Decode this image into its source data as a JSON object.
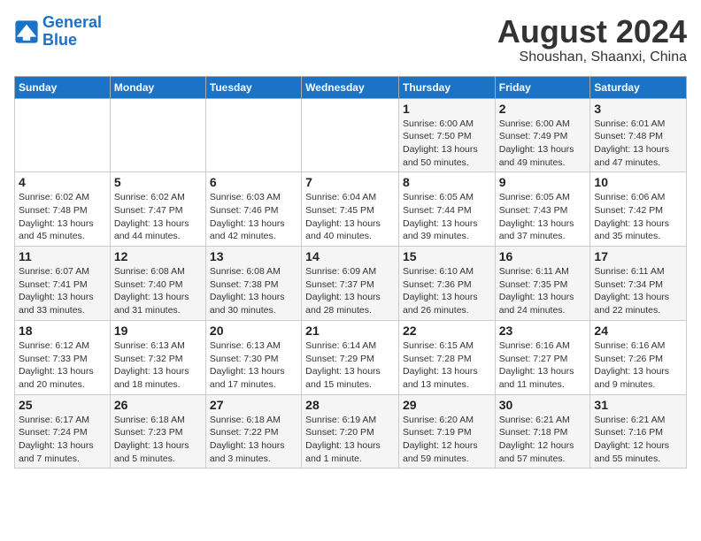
{
  "logo": {
    "text_general": "General",
    "text_blue": "Blue"
  },
  "title": "August 2024",
  "subtitle": "Shoushan, Shaanxi, China",
  "days_of_week": [
    "Sunday",
    "Monday",
    "Tuesday",
    "Wednesday",
    "Thursday",
    "Friday",
    "Saturday"
  ],
  "weeks": [
    [
      {
        "day": "",
        "detail": ""
      },
      {
        "day": "",
        "detail": ""
      },
      {
        "day": "",
        "detail": ""
      },
      {
        "day": "",
        "detail": ""
      },
      {
        "day": "1",
        "detail": "Sunrise: 6:00 AM\nSunset: 7:50 PM\nDaylight: 13 hours and 50 minutes."
      },
      {
        "day": "2",
        "detail": "Sunrise: 6:00 AM\nSunset: 7:49 PM\nDaylight: 13 hours and 49 minutes."
      },
      {
        "day": "3",
        "detail": "Sunrise: 6:01 AM\nSunset: 7:48 PM\nDaylight: 13 hours and 47 minutes."
      }
    ],
    [
      {
        "day": "4",
        "detail": "Sunrise: 6:02 AM\nSunset: 7:48 PM\nDaylight: 13 hours and 45 minutes."
      },
      {
        "day": "5",
        "detail": "Sunrise: 6:02 AM\nSunset: 7:47 PM\nDaylight: 13 hours and 44 minutes."
      },
      {
        "day": "6",
        "detail": "Sunrise: 6:03 AM\nSunset: 7:46 PM\nDaylight: 13 hours and 42 minutes."
      },
      {
        "day": "7",
        "detail": "Sunrise: 6:04 AM\nSunset: 7:45 PM\nDaylight: 13 hours and 40 minutes."
      },
      {
        "day": "8",
        "detail": "Sunrise: 6:05 AM\nSunset: 7:44 PM\nDaylight: 13 hours and 39 minutes."
      },
      {
        "day": "9",
        "detail": "Sunrise: 6:05 AM\nSunset: 7:43 PM\nDaylight: 13 hours and 37 minutes."
      },
      {
        "day": "10",
        "detail": "Sunrise: 6:06 AM\nSunset: 7:42 PM\nDaylight: 13 hours and 35 minutes."
      }
    ],
    [
      {
        "day": "11",
        "detail": "Sunrise: 6:07 AM\nSunset: 7:41 PM\nDaylight: 13 hours and 33 minutes."
      },
      {
        "day": "12",
        "detail": "Sunrise: 6:08 AM\nSunset: 7:40 PM\nDaylight: 13 hours and 31 minutes."
      },
      {
        "day": "13",
        "detail": "Sunrise: 6:08 AM\nSunset: 7:38 PM\nDaylight: 13 hours and 30 minutes."
      },
      {
        "day": "14",
        "detail": "Sunrise: 6:09 AM\nSunset: 7:37 PM\nDaylight: 13 hours and 28 minutes."
      },
      {
        "day": "15",
        "detail": "Sunrise: 6:10 AM\nSunset: 7:36 PM\nDaylight: 13 hours and 26 minutes."
      },
      {
        "day": "16",
        "detail": "Sunrise: 6:11 AM\nSunset: 7:35 PM\nDaylight: 13 hours and 24 minutes."
      },
      {
        "day": "17",
        "detail": "Sunrise: 6:11 AM\nSunset: 7:34 PM\nDaylight: 13 hours and 22 minutes."
      }
    ],
    [
      {
        "day": "18",
        "detail": "Sunrise: 6:12 AM\nSunset: 7:33 PM\nDaylight: 13 hours and 20 minutes."
      },
      {
        "day": "19",
        "detail": "Sunrise: 6:13 AM\nSunset: 7:32 PM\nDaylight: 13 hours and 18 minutes."
      },
      {
        "day": "20",
        "detail": "Sunrise: 6:13 AM\nSunset: 7:30 PM\nDaylight: 13 hours and 17 minutes."
      },
      {
        "day": "21",
        "detail": "Sunrise: 6:14 AM\nSunset: 7:29 PM\nDaylight: 13 hours and 15 minutes."
      },
      {
        "day": "22",
        "detail": "Sunrise: 6:15 AM\nSunset: 7:28 PM\nDaylight: 13 hours and 13 minutes."
      },
      {
        "day": "23",
        "detail": "Sunrise: 6:16 AM\nSunset: 7:27 PM\nDaylight: 13 hours and 11 minutes."
      },
      {
        "day": "24",
        "detail": "Sunrise: 6:16 AM\nSunset: 7:26 PM\nDaylight: 13 hours and 9 minutes."
      }
    ],
    [
      {
        "day": "25",
        "detail": "Sunrise: 6:17 AM\nSunset: 7:24 PM\nDaylight: 13 hours and 7 minutes."
      },
      {
        "day": "26",
        "detail": "Sunrise: 6:18 AM\nSunset: 7:23 PM\nDaylight: 13 hours and 5 minutes."
      },
      {
        "day": "27",
        "detail": "Sunrise: 6:18 AM\nSunset: 7:22 PM\nDaylight: 13 hours and 3 minutes."
      },
      {
        "day": "28",
        "detail": "Sunrise: 6:19 AM\nSunset: 7:20 PM\nDaylight: 13 hours and 1 minute."
      },
      {
        "day": "29",
        "detail": "Sunrise: 6:20 AM\nSunset: 7:19 PM\nDaylight: 12 hours and 59 minutes."
      },
      {
        "day": "30",
        "detail": "Sunrise: 6:21 AM\nSunset: 7:18 PM\nDaylight: 12 hours and 57 minutes."
      },
      {
        "day": "31",
        "detail": "Sunrise: 6:21 AM\nSunset: 7:16 PM\nDaylight: 12 hours and 55 minutes."
      }
    ]
  ]
}
